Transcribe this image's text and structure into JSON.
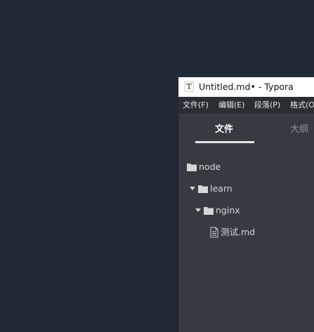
{
  "window": {
    "title": "Untitled.md• - Typora",
    "app_icon_letter": "T"
  },
  "menubar": {
    "items": [
      "文件(F)",
      "编辑(E)",
      "段落(P)",
      "格式(O)"
    ]
  },
  "sidebar": {
    "tabs": [
      {
        "label": "文件",
        "active": true
      },
      {
        "label": "大纲",
        "active": false
      }
    ],
    "tree": [
      {
        "type": "folder",
        "label": "node",
        "expanded": false
      },
      {
        "type": "folder",
        "label": "learn",
        "expanded": true
      },
      {
        "type": "folder",
        "label": "nginx",
        "expanded": true
      },
      {
        "type": "file",
        "label": "测试.md"
      }
    ]
  },
  "colors": {
    "desktop": "#212a36",
    "sidebar": "#363b42",
    "menubar": "#2a2d32",
    "titlebar": "#ffffff"
  }
}
